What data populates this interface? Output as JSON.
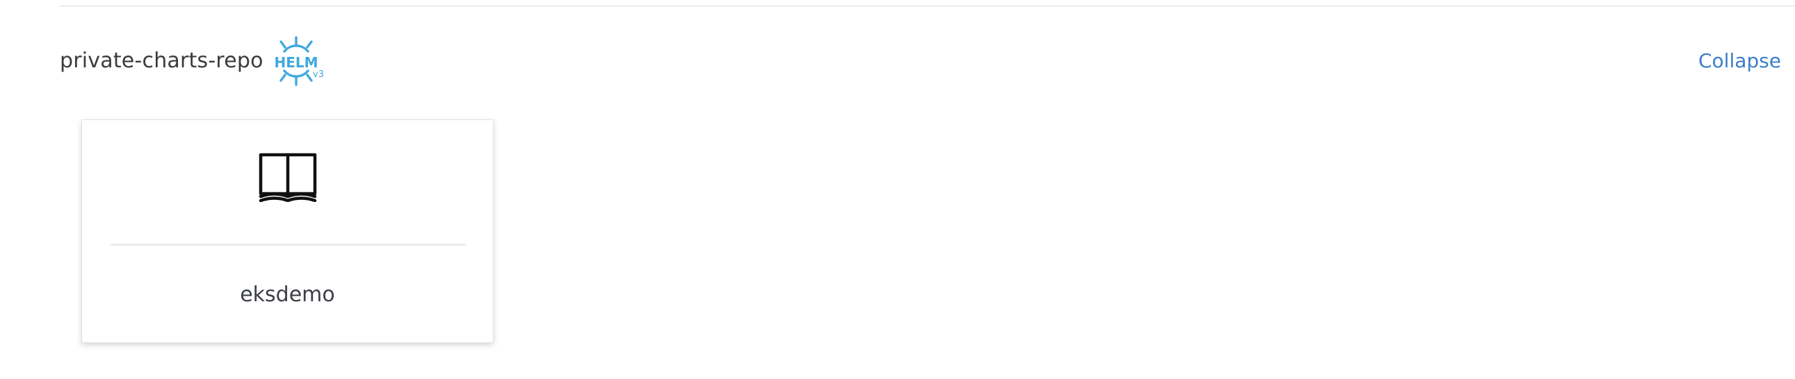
{
  "repository": {
    "name": "private-charts-repo",
    "badge": {
      "icon": "helm-v3-icon",
      "text": "HELM",
      "version": "v3",
      "color": "#3fa9dc"
    },
    "collapse_label": "Collapse",
    "link_color": "#3b7ec8"
  },
  "charts": [
    {
      "name": "eksdemo",
      "icon": "book-icon"
    }
  ]
}
